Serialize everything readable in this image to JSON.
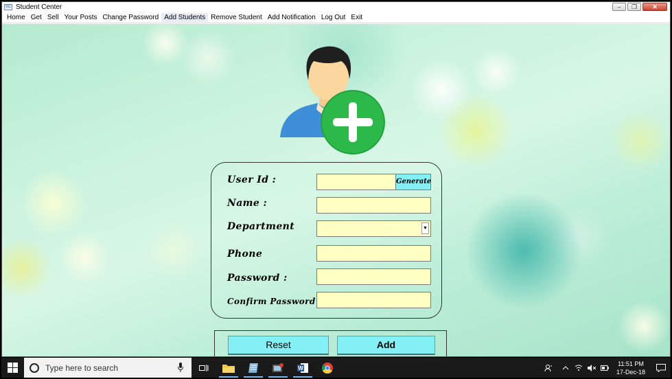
{
  "window": {
    "title": "Student Center"
  },
  "menu": [
    {
      "label": "Home"
    },
    {
      "label": "Get"
    },
    {
      "label": "Sell"
    },
    {
      "label": "Your Posts"
    },
    {
      "label": "Change Password"
    },
    {
      "label": "Add Students",
      "active": true
    },
    {
      "label": "Remove Student"
    },
    {
      "label": "Add Notification"
    },
    {
      "label": "Log Out"
    },
    {
      "label": "Exit"
    }
  ],
  "form": {
    "user_id_label": "User Id :",
    "generate_label": "Generate",
    "name_label": "Name :",
    "department_label": "Department",
    "phone_label": "Phone",
    "password_label": "Password :",
    "confirm_password_label": "Confirm Password :",
    "user_id_value": "",
    "name_value": "",
    "department_value": "",
    "phone_value": "",
    "password_value": "",
    "confirm_password_value": ""
  },
  "buttons": {
    "reset_label": "Reset",
    "add_label": "Add"
  },
  "taskbar": {
    "search_placeholder": "Type here to search",
    "time": "11:51 PM",
    "date": "17-Dec-18"
  },
  "colors": {
    "field_bg": "#ffffc4",
    "button_bg": "#82f0f4",
    "plus_green": "#2db84a",
    "shirt_blue": "#3e8fd8",
    "taskbar_bg": "#1a1a1a"
  },
  "icons": [
    "add-user-icon",
    "windows-start-icon",
    "search-icon",
    "microphone-icon",
    "task-view-icon",
    "file-explorer-icon",
    "notepad-icon",
    "app-icon",
    "word-icon",
    "chrome-icon",
    "people-icon",
    "chevron-up-icon",
    "wifi-icon",
    "speaker-mute-icon",
    "battery-icon",
    "notification-icon"
  ]
}
